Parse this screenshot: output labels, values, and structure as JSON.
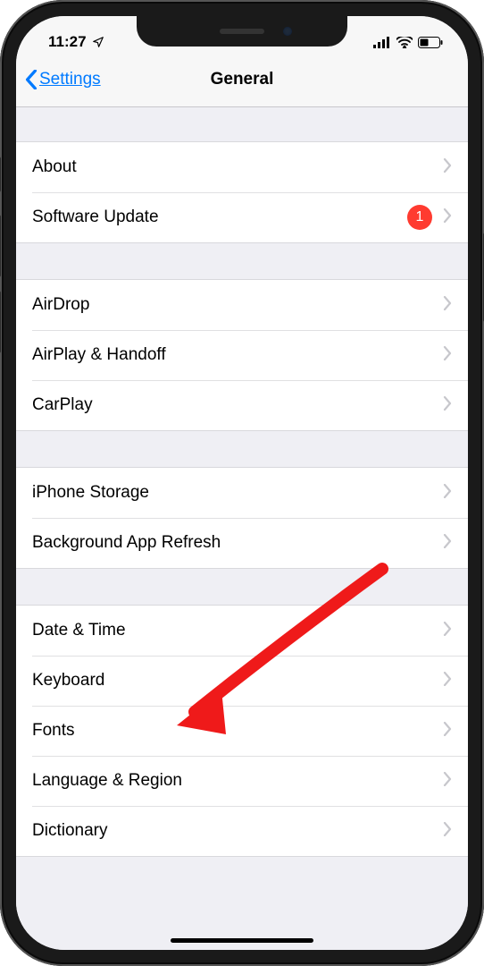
{
  "statusbar": {
    "time": "11:27"
  },
  "nav": {
    "back_label": "Settings",
    "title": "General"
  },
  "groups": [
    {
      "items": [
        {
          "key": "about",
          "label": "About",
          "badge": null
        },
        {
          "key": "software-update",
          "label": "Software Update",
          "badge": "1"
        }
      ]
    },
    {
      "items": [
        {
          "key": "airdrop",
          "label": "AirDrop",
          "badge": null
        },
        {
          "key": "airplay-handoff",
          "label": "AirPlay & Handoff",
          "badge": null
        },
        {
          "key": "carplay",
          "label": "CarPlay",
          "badge": null
        }
      ]
    },
    {
      "items": [
        {
          "key": "iphone-storage",
          "label": "iPhone Storage",
          "badge": null
        },
        {
          "key": "background-app-refresh",
          "label": "Background App Refresh",
          "badge": null
        }
      ]
    },
    {
      "items": [
        {
          "key": "date-time",
          "label": "Date & Time",
          "badge": null
        },
        {
          "key": "keyboard",
          "label": "Keyboard",
          "badge": null
        },
        {
          "key": "fonts",
          "label": "Fonts",
          "badge": null
        },
        {
          "key": "language-region",
          "label": "Language & Region",
          "badge": null
        },
        {
          "key": "dictionary",
          "label": "Dictionary",
          "badge": null
        }
      ]
    }
  ],
  "annotation": {
    "target": "keyboard"
  },
  "colors": {
    "accent": "#007aff",
    "badge": "#ff3b30",
    "arrow": "#ef1a1a"
  }
}
